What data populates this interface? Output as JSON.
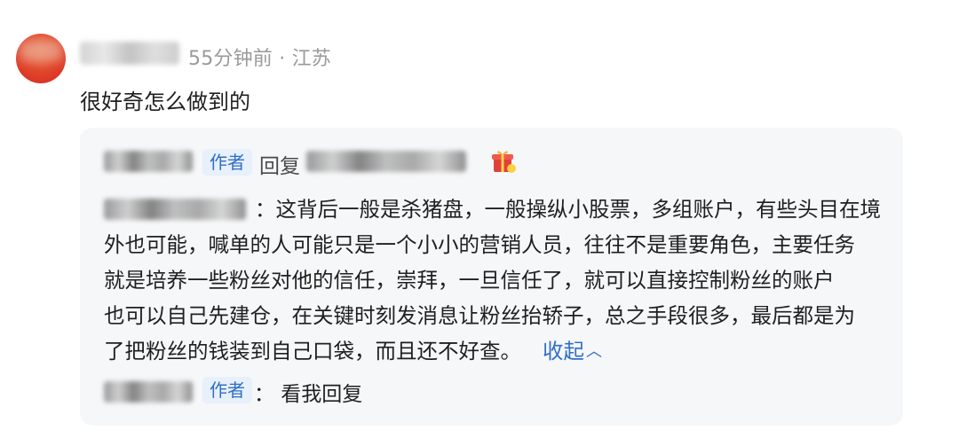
{
  "comment": {
    "meta": "55分钟前 · 江苏",
    "text": "很好奇怎么做到的"
  },
  "reply_thread": {
    "author_tag": "作者",
    "reply_label": "回复",
    "body_lines": [
      "：这背后一般是杀猪盘，一般操纵小股票，多组账户，有些头目在境",
      "外也可能，喊单的人可能只是一个小小的营销人员，往往不是重要角色，主要任务",
      "就是培养一些粉丝对他的信任，崇拜，一旦信任了，就可以直接控制粉丝的账户",
      "也可以自己先建仓，在关键时刻发消息让粉丝抬轿子，总之手段很多，最后都是为",
      "了把粉丝的钱装到自己口袋，而且还不好查。"
    ],
    "collapse_label": "收起",
    "sub_reply_tag": "作者",
    "sub_reply_text": "：  看我回复"
  },
  "icons": {
    "gift": "gift-icon",
    "collapse": "chevron-up-icon"
  },
  "colors": {
    "accent": "#2f6fc7",
    "tag_bg": "#e7f0fb",
    "box_bg": "#f6f7f9",
    "meta": "#9a9a9a"
  }
}
